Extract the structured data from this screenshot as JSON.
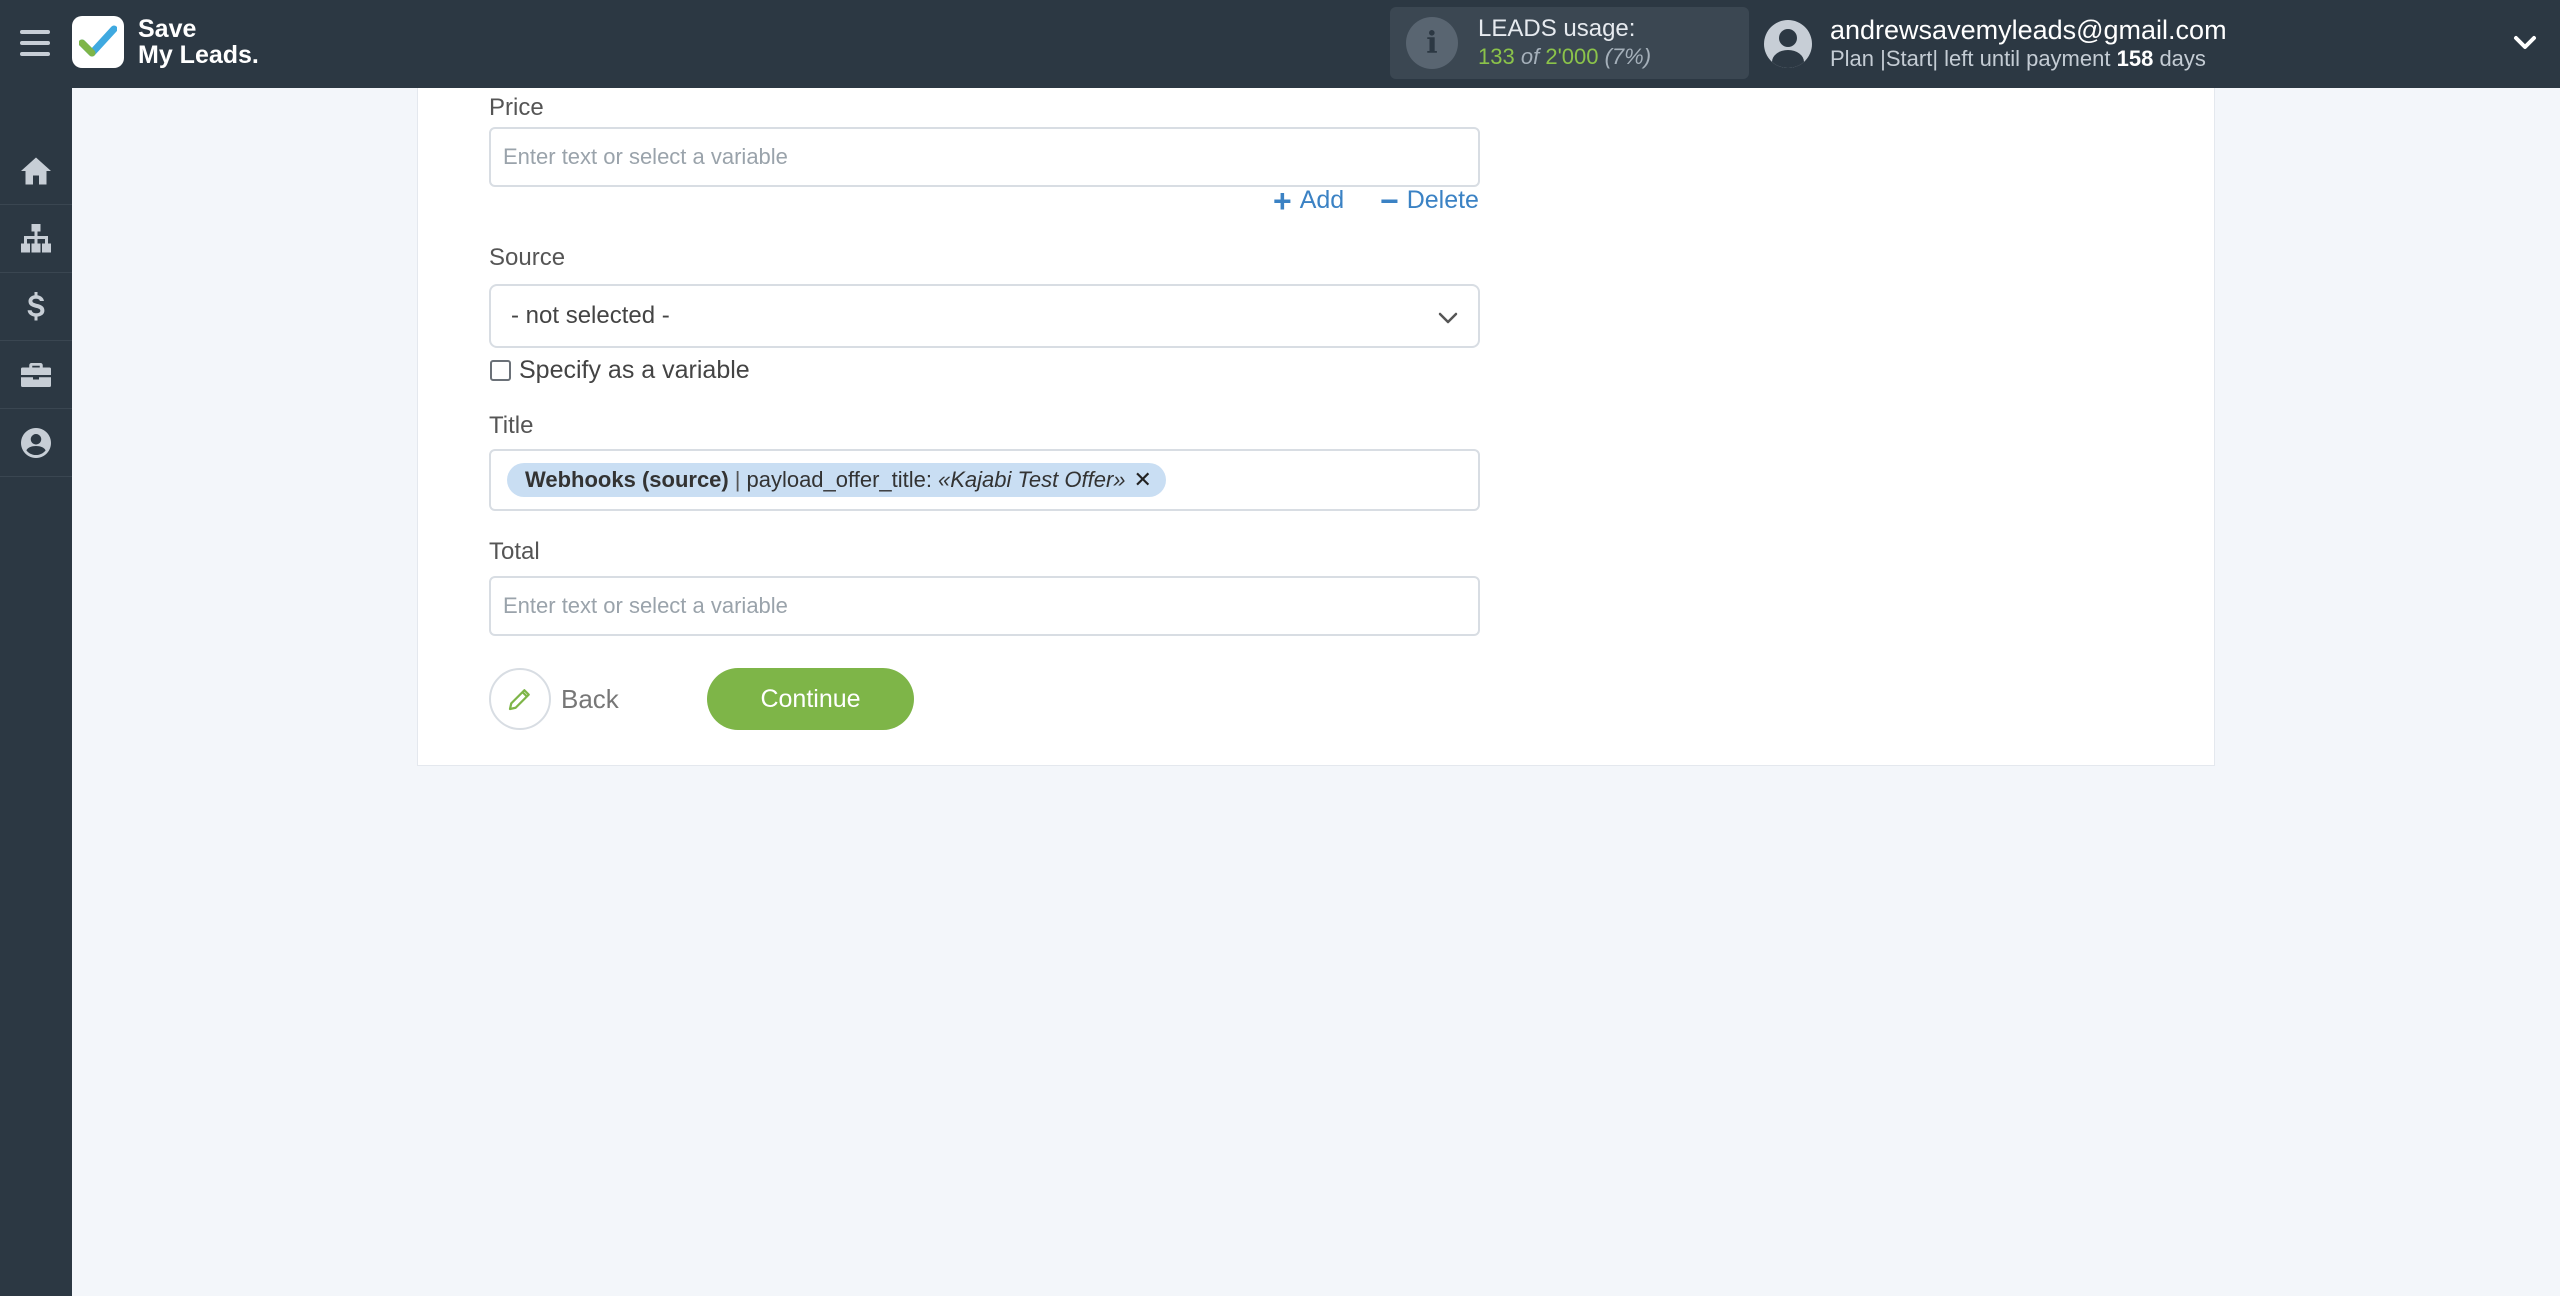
{
  "header": {
    "logo_line1": "Save",
    "logo_line2": "My Leads.",
    "usage_label": "LEADS usage:",
    "usage_used": "133",
    "usage_of": "of",
    "usage_total": "2'000",
    "usage_percent": "(7%)",
    "account_email": "andrewsavemyleads@gmail.com",
    "plan_text": "Plan |Start| left until payment",
    "days_left": "158",
    "days_word": "days"
  },
  "sidebar": {
    "items": [
      {
        "name": "home",
        "icon": "home-icon"
      },
      {
        "name": "connections",
        "icon": "sitemap-icon"
      },
      {
        "name": "billing",
        "icon": "dollar-icon"
      },
      {
        "name": "tools",
        "icon": "briefcase-icon"
      },
      {
        "name": "profile",
        "icon": "user-circle-icon"
      }
    ]
  },
  "form": {
    "price": {
      "label": "Price",
      "placeholder": "Enter text or select a variable",
      "value": ""
    },
    "add_label": "Add",
    "delete_label": "Delete",
    "source": {
      "label": "Source",
      "selected": "- not selected -"
    },
    "specify_variable_label": "Specify as a variable",
    "specify_variable_checked": false,
    "title": {
      "label": "Title",
      "tag_source": "Webhooks (source)",
      "tag_separator": "|",
      "tag_field": "payload_offer_title:",
      "tag_value": "«Kajabi Test Offer»"
    },
    "total": {
      "label": "Total",
      "placeholder": "Enter text or select a variable",
      "value": ""
    },
    "back_label": "Back",
    "continue_label": "Continue"
  },
  "colors": {
    "topbar": "#2c3843",
    "accent_green": "#7eb548",
    "link_blue": "#3b82c4",
    "tag_bg": "#c9def3"
  }
}
